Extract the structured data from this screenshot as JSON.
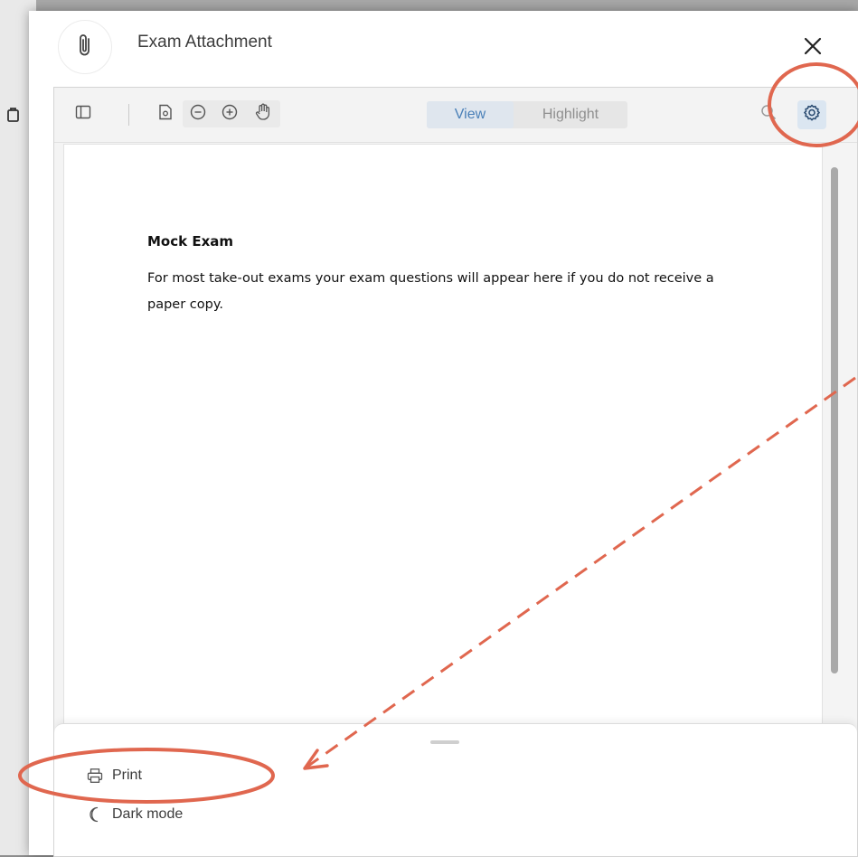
{
  "modal": {
    "title": "Exam Attachment"
  },
  "toolbar": {
    "tabs": [
      {
        "label": "View",
        "active": true
      },
      {
        "label": "Highlight",
        "active": false
      }
    ]
  },
  "document": {
    "title": "Mock Exam",
    "body": "For most take-out exams your exam questions will appear here if you do not receive a paper copy."
  },
  "settings_menu": {
    "items": [
      {
        "label": "Print",
        "icon": "printer-icon"
      },
      {
        "label": "Dark mode",
        "icon": "moon-icon"
      }
    ]
  },
  "colors": {
    "accent": "#4a80b8",
    "annotation": "#e0674f",
    "gear_bg": "#dbe6f1"
  }
}
